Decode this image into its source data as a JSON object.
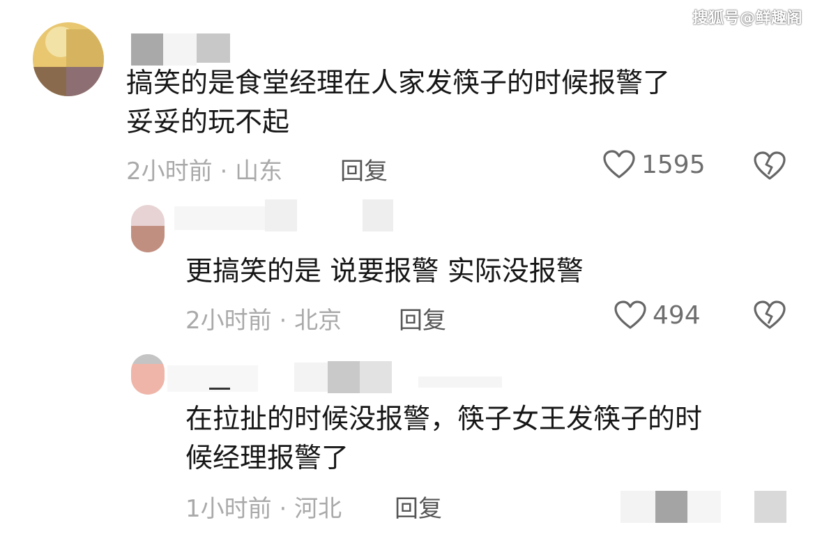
{
  "watermark": "搜狐号@鲜趣阁",
  "comments": [
    {
      "text_lines": [
        "搞笑的是食堂经理在人家发筷子的时候报警了",
        "妥妥的玩不起"
      ],
      "time": "2小时前",
      "location": "山东",
      "reply_label": "回复",
      "likes": "1595",
      "icons": {
        "like": "heart-outline-icon",
        "dislike": "broken-heart-icon"
      }
    },
    {
      "text_lines": [
        "更搞笑的是 说要报警 实际没报警"
      ],
      "time": "2小时前",
      "location": "北京",
      "reply_label": "回复",
      "likes": "494",
      "icons": {
        "like": "heart-outline-icon",
        "dislike": "broken-heart-icon"
      }
    },
    {
      "text_lines": [
        "在拉扯的时候没报警，筷子女王发筷子的时",
        "候经理报警了"
      ],
      "time": "1小时前",
      "location": "河北",
      "reply_label": "回复"
    }
  ]
}
